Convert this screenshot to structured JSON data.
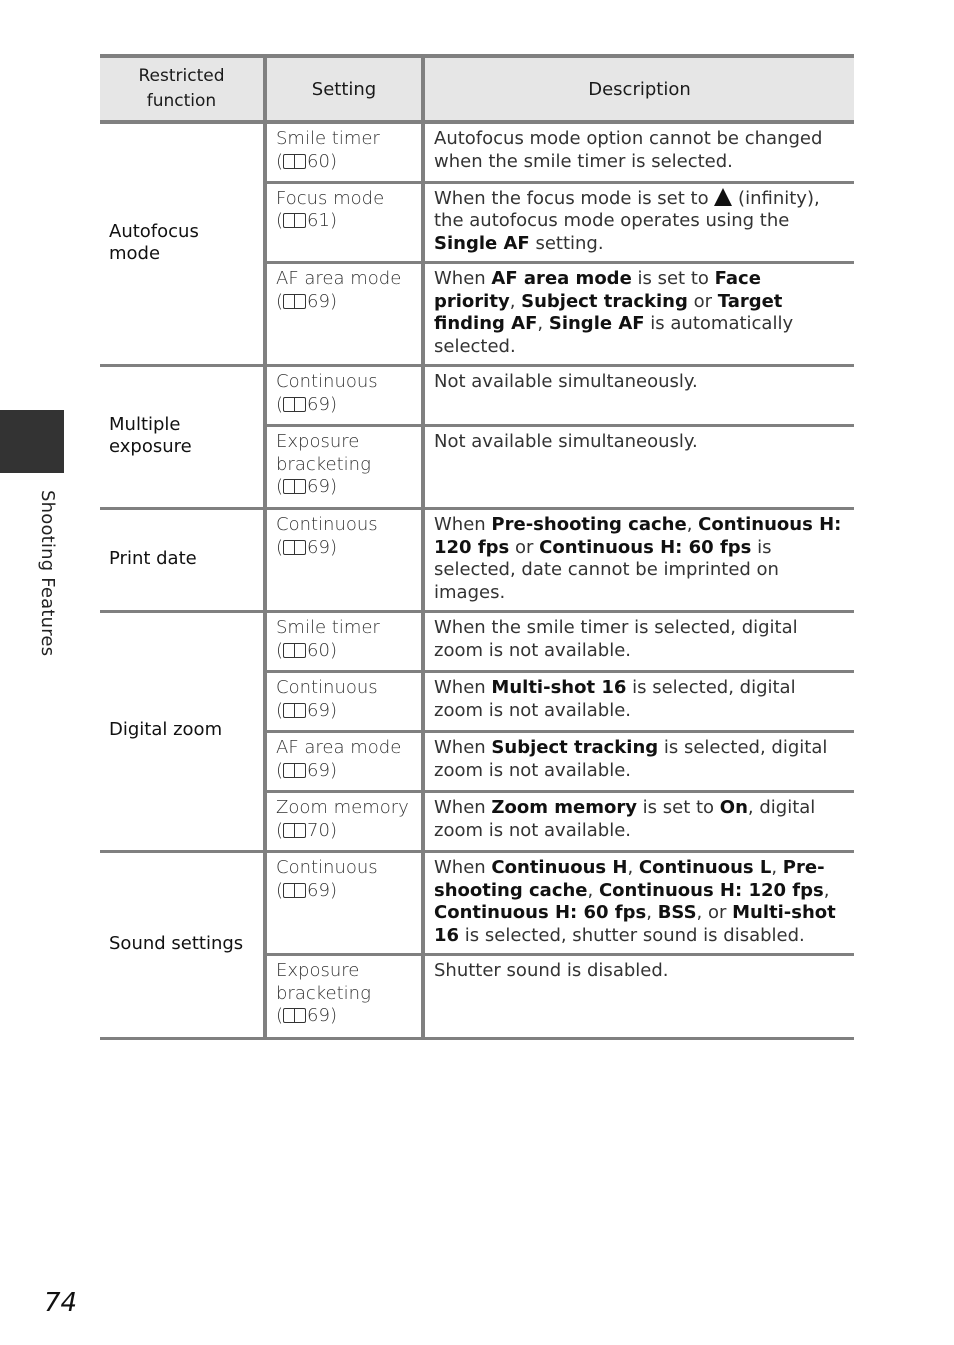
{
  "side_tab": {
    "label": "Shooting Features"
  },
  "page_number": "74",
  "table": {
    "headers": [
      "Restricted function",
      "Setting",
      "Description"
    ],
    "groups": [
      {
        "function": "Autofocus mode",
        "rows": [
          {
            "setting": "Smile timer",
            "ref": "60",
            "desc": [
              {
                "t": "Autofocus mode option cannot be changed when the smile timer is selected."
              }
            ]
          },
          {
            "setting": "Focus mode",
            "ref": "61",
            "desc": [
              {
                "t": "When the focus mode is set to "
              },
              {
                "icon": "infinity-mountain-icon"
              },
              {
                "t": " (infinity), the autofocus mode operates using the "
              },
              {
                "b": "Single AF"
              },
              {
                "t": " setting."
              }
            ]
          },
          {
            "setting": "AF area mode",
            "ref": "69",
            "desc": [
              {
                "t": "When "
              },
              {
                "b": "AF area mode"
              },
              {
                "t": " is set to "
              },
              {
                "b": "Face priority"
              },
              {
                "t": ", "
              },
              {
                "b": "Subject tracking"
              },
              {
                "t": " or "
              },
              {
                "b": "Target finding AF"
              },
              {
                "t": ", "
              },
              {
                "b": "Single AF"
              },
              {
                "t": " is automatically selected."
              }
            ]
          }
        ]
      },
      {
        "function": "Multiple exposure",
        "rows": [
          {
            "setting": "Continuous",
            "ref": "69",
            "desc": [
              {
                "t": "Not available simultaneously."
              }
            ]
          },
          {
            "setting": "Exposure bracketing",
            "ref": "69",
            "desc": [
              {
                "t": "Not available simultaneously."
              }
            ]
          }
        ]
      },
      {
        "function": "Print date",
        "rows": [
          {
            "setting": "Continuous",
            "ref": "69",
            "desc": [
              {
                "t": "When "
              },
              {
                "b": "Pre-shooting cache"
              },
              {
                "t": ", "
              },
              {
                "b": "Continuous H: 120 fps"
              },
              {
                "t": " or "
              },
              {
                "b": "Continuous H: 60 fps"
              },
              {
                "t": " is selected, date cannot be imprinted on images."
              }
            ]
          }
        ]
      },
      {
        "function": "Digital zoom",
        "rows": [
          {
            "setting": "Smile timer",
            "ref": "60",
            "desc": [
              {
                "t": "When the smile timer is selected, digital zoom is not available."
              }
            ]
          },
          {
            "setting": "Continuous",
            "ref": "69",
            "desc": [
              {
                "t": "When "
              },
              {
                "b": "Multi-shot 16"
              },
              {
                "t": " is selected, digital zoom is not available."
              }
            ]
          },
          {
            "setting": "AF area mode",
            "ref": "69",
            "desc": [
              {
                "t": "When "
              },
              {
                "b": "Subject tracking"
              },
              {
                "t": " is selected, digital zoom is not available."
              }
            ]
          },
          {
            "setting": "Zoom memory",
            "ref": "70",
            "desc": [
              {
                "t": "When "
              },
              {
                "b": "Zoom memory"
              },
              {
                "t": " is set to "
              },
              {
                "b": "On"
              },
              {
                "t": ", digital zoom is not available."
              }
            ]
          }
        ]
      },
      {
        "function": "Sound settings",
        "rows": [
          {
            "setting": "Continuous",
            "ref": "69",
            "desc": [
              {
                "t": "When "
              },
              {
                "b": "Continuous H"
              },
              {
                "t": ", "
              },
              {
                "b": "Continuous L"
              },
              {
                "t": ", "
              },
              {
                "b": "Pre-shooting cache"
              },
              {
                "t": ", "
              },
              {
                "b": "Continuous H: 120 fps"
              },
              {
                "t": ", "
              },
              {
                "b": "Continuous H: 60 fps"
              },
              {
                "t": ", "
              },
              {
                "b": "BSS"
              },
              {
                "t": ", or "
              },
              {
                "b": "Multi-shot 16"
              },
              {
                "t": " is selected, shutter sound is disabled."
              }
            ]
          },
          {
            "setting": "Exposure bracketing",
            "ref": "69",
            "desc": [
              {
                "t": "Shutter sound is disabled."
              }
            ]
          }
        ]
      }
    ]
  }
}
